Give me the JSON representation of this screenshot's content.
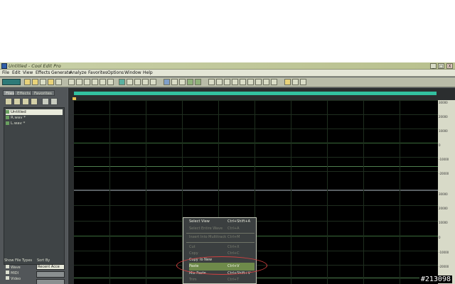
{
  "window": {
    "title": "Untitled - Cool Edit Pro",
    "btn_min": "_",
    "btn_max": "□",
    "btn_close": "X"
  },
  "menu": [
    "File",
    "Edit",
    "View",
    "Effects",
    "Generate",
    "Analyze",
    "Favorites",
    "Options",
    "Window",
    "Help"
  ],
  "left_panel": {
    "tabs": [
      "Files",
      "Effects",
      "Favorites"
    ],
    "files": [
      "Untitled",
      "R.wav *",
      "L.wav *"
    ],
    "show_file_types_label": "Show File Types",
    "sort_by_label": "Sort By",
    "types": [
      "Wave",
      "MIDI",
      "Video"
    ],
    "sort_value": "Recent Acce"
  },
  "ruler": {
    "top": [
      "30000",
      "20000",
      "10000",
      "0",
      "-10000",
      "-20000"
    ],
    "bottom": [
      "30000",
      "20000",
      "10000",
      "0",
      "-10000",
      "-20000"
    ]
  },
  "context_menu": {
    "items": [
      {
        "label": "Select View",
        "shortcut": "Ctrl+Shift+A",
        "disabled": false
      },
      {
        "label": "Select Entire Wave",
        "shortcut": "Ctrl+A",
        "disabled": true
      },
      {
        "label": "Insert Into Multitrack",
        "shortcut": "Ctrl+M",
        "disabled": true
      },
      {
        "label": "Cut",
        "shortcut": "Ctrl+X",
        "disabled": true
      },
      {
        "label": "Copy",
        "shortcut": "Ctrl+C",
        "disabled": true
      },
      {
        "label": "Copy To New",
        "shortcut": "",
        "disabled": false
      },
      {
        "label": "Paste",
        "shortcut": "Ctrl+V",
        "disabled": false,
        "highlighted": true
      },
      {
        "label": "Mix Paste",
        "shortcut": "Ctrl+Shift+V",
        "disabled": false
      },
      {
        "label": "Trim",
        "shortcut": "Ctrl+T",
        "disabled": true
      }
    ]
  },
  "watermark": "#213098"
}
